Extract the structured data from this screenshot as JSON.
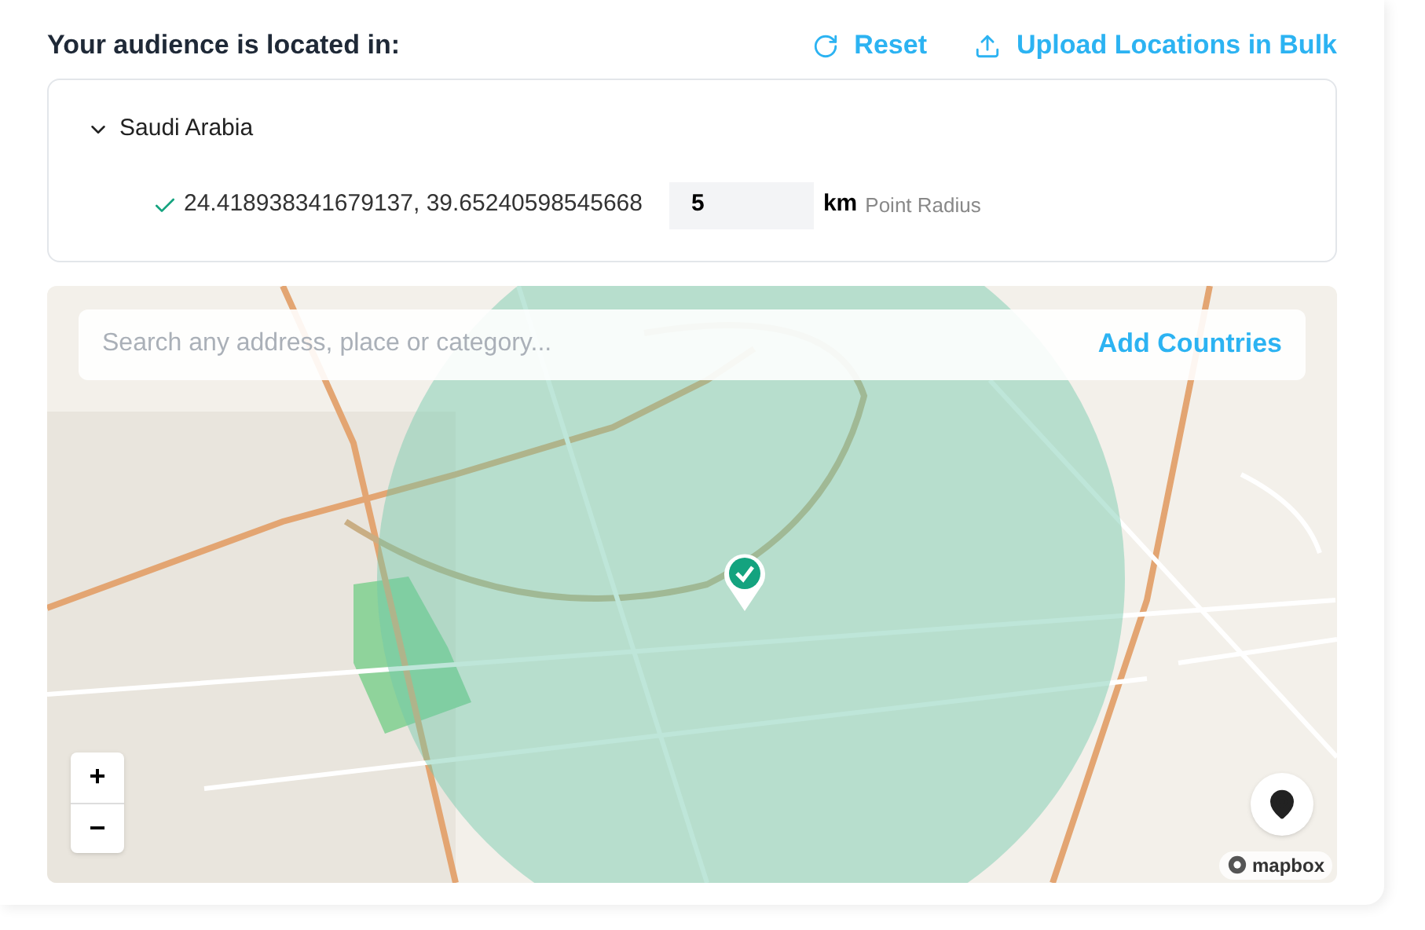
{
  "header": {
    "title": "Your audience is located in:",
    "actions": [
      {
        "label": "Reset",
        "kind": "reset"
      },
      {
        "label": "Upload Locations in Bulk",
        "kind": "upload"
      }
    ]
  },
  "locations": [
    {
      "country": "Saudi Arabia",
      "expanded": true,
      "points": [
        {
          "coords": "24.418938341679137, 39.65240598545668",
          "radius": "5",
          "unit": "km",
          "hint": "Point Radius"
        }
      ]
    }
  ],
  "map": {
    "search": {
      "placeholder": "Search any address, place or category...",
      "action": "Add Countries"
    },
    "zoom": [
      "+",
      "−"
    ],
    "attribution": "mapbox"
  }
}
